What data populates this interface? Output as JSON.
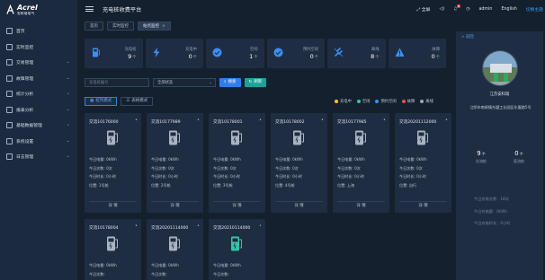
{
  "brand": {
    "name": "Acrel",
    "subtitle": "安科瑞电气"
  },
  "app_title": "充电桩收费平台",
  "top_right": {
    "fullscreen": "全屏",
    "notification_count": "8",
    "user": "admin",
    "language": "English",
    "language_alt": "切换主题"
  },
  "sidebar": {
    "items": [
      {
        "label": "首页",
        "icon": "home-icon",
        "expandable": false
      },
      {
        "label": "实时监控",
        "icon": "monitor-icon",
        "expandable": false
      },
      {
        "label": "交易管理",
        "icon": "transaction-icon",
        "expandable": true
      },
      {
        "label": "故障管理",
        "icon": "fault-icon",
        "expandable": true
      },
      {
        "label": "统计分析",
        "icon": "chart-icon",
        "expandable": true
      },
      {
        "label": "报表分析",
        "icon": "report-icon",
        "expandable": true
      },
      {
        "label": "基础数据管理",
        "icon": "database-icon",
        "expandable": true
      },
      {
        "label": "系统设置",
        "icon": "settings-icon",
        "expandable": true
      },
      {
        "label": "日志管理",
        "icon": "log-icon",
        "expandable": true
      }
    ]
  },
  "tabs": [
    {
      "label": "首页",
      "active": false
    },
    {
      "label": "实时监控",
      "active": false
    },
    {
      "label": "站点监控",
      "active": true,
      "close": "×"
    }
  ],
  "stats": [
    {
      "label": "充电桩",
      "value": "9",
      "unit": "个",
      "icon": "charger-icon",
      "color": "#3b8ff5"
    },
    {
      "label": "充电中",
      "value": "0",
      "unit": "个",
      "icon": "lightning-icon",
      "color": "#3b8ff5"
    },
    {
      "label": "空闲",
      "value": "1",
      "unit": "个",
      "icon": "check-circle-icon",
      "color": "#3b8ff5"
    },
    {
      "label": "预约空闲",
      "value": "0",
      "unit": "个",
      "icon": "check-circle-icon",
      "color": "#3b8ff5"
    },
    {
      "label": "离线",
      "value": "8",
      "unit": "个",
      "icon": "disconnect-icon",
      "color": "#3b8ff5"
    },
    {
      "label": "故障",
      "value": "0",
      "unit": "个",
      "icon": "warning-icon",
      "color": "#3b8ff5"
    }
  ],
  "filter": {
    "search_placeholder": "充电桩编号",
    "status_value": "全部状态",
    "search_label": "搜索",
    "refresh_label": "刷新"
  },
  "view_modes": [
    {
      "label": "桩列模式",
      "active": true
    },
    {
      "label": "表格模式",
      "active": false
    }
  ],
  "legend": [
    {
      "label": "充电中",
      "color": "#f5c330"
    },
    {
      "label": "空闲",
      "color": "#2fc7a7"
    },
    {
      "label": "预约空闲",
      "color": "#3f8ef5"
    },
    {
      "label": "故障",
      "color": "#f04c4c"
    },
    {
      "label": "离线",
      "color": "#9aa6b4"
    }
  ],
  "card_labels": {
    "power": "今日电量:",
    "count": "今日次数:",
    "duration": "今日时长:",
    "location": "位置:",
    "detail": "详 情"
  },
  "cards": [
    {
      "name": "交流10176000",
      "power": "0kWh",
      "count": "0次",
      "duration": "0小时",
      "location": "1号枪",
      "status": "offline"
    },
    {
      "name": "交流10177989",
      "power": "0kWh",
      "count": "0次",
      "duration": "0小时",
      "location": "2号枪",
      "status": "offline"
    },
    {
      "name": "交流10178001",
      "power": "0kWh",
      "count": "0次",
      "duration": "0小时",
      "location": "3号枪",
      "status": "offline"
    },
    {
      "name": "交流10178002",
      "power": "0kWh",
      "count": "0次",
      "duration": "0小时",
      "location": "4号枪",
      "status": "offline"
    },
    {
      "name": "交流10177985",
      "power": "0kWh",
      "count": "0次",
      "duration": "0小时",
      "location": "上海",
      "status": "offline"
    },
    {
      "name": "交流20201112000",
      "power": "0kWh",
      "count": "0次",
      "duration": "0小时",
      "location": "自行",
      "status": "offline"
    },
    {
      "name": "交流10178004",
      "power": "0kWh",
      "count": "",
      "duration": "",
      "location": "",
      "status": "offline"
    },
    {
      "name": "交流20201114000",
      "power": "0kWh",
      "count": "",
      "duration": "",
      "location": "",
      "status": "offline"
    },
    {
      "name": "交流20210114000",
      "power": "0kWh",
      "count": "",
      "duration": "",
      "location": "",
      "status": "idle"
    }
  ],
  "right_panel": {
    "header": "> 返回",
    "station_name": "江苏安科瑞",
    "address": "江阴市南闸镇东盟工业园区东盟路5号",
    "summary": [
      {
        "value": "9",
        "unit": "个",
        "label": "交流桩"
      },
      {
        "value": "0",
        "unit": "个",
        "label": "直流桩"
      }
    ],
    "today": [
      {
        "label": "今日充电次数：",
        "value": "18次"
      },
      {
        "label": "今日充电量：",
        "value": "0kWh"
      },
      {
        "label": "今日充电时长：",
        "value": "0小时"
      }
    ]
  }
}
